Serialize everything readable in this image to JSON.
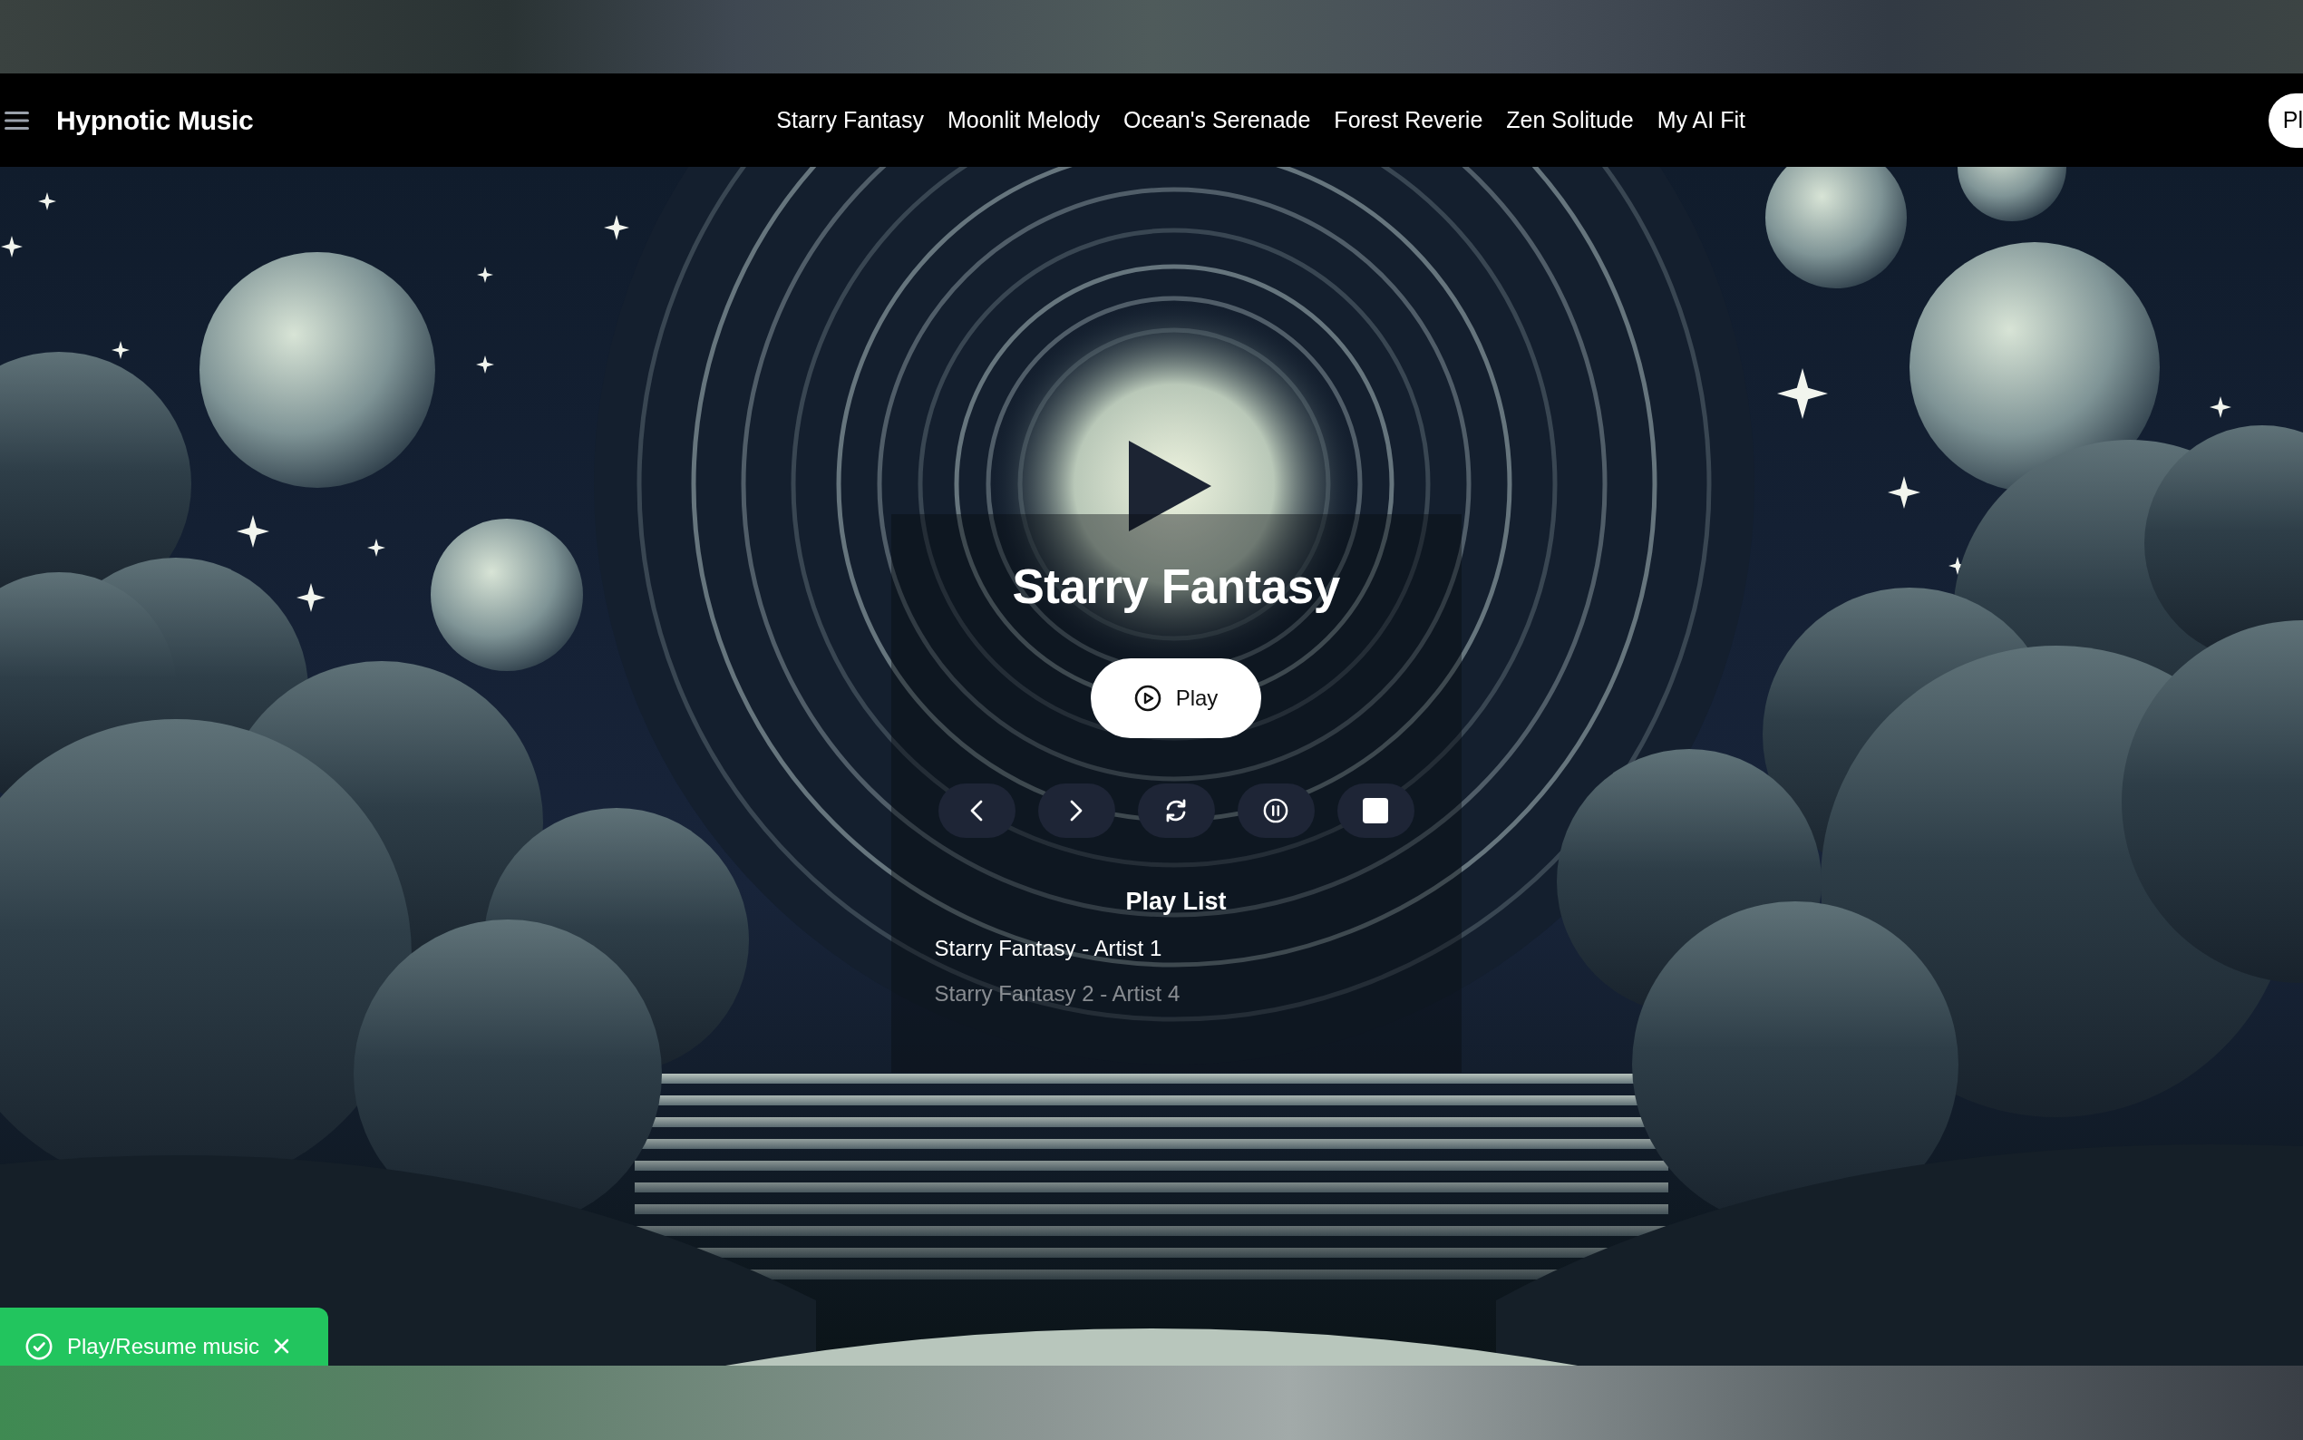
{
  "nav": {
    "brand": "Hypnotic Music",
    "links": [
      "Starry Fantasy",
      "Moonlit Melody",
      "Ocean's Serenade",
      "Forest Reverie",
      "Zen Solitude",
      "My AI Fit"
    ],
    "button": "Pl"
  },
  "player": {
    "title": "Starry Fantasy",
    "play_button": "Play",
    "controls": [
      {
        "kind": "previous"
      },
      {
        "kind": "next"
      },
      {
        "kind": "repeat"
      },
      {
        "kind": "pause"
      },
      {
        "kind": "stop"
      }
    ],
    "playlist": {
      "title": "Play List",
      "items": [
        {
          "label": "Starry Fantasy - Artist 1",
          "selected": true
        },
        {
          "label": "Starry Fantasy 2 - Artist 4",
          "selected": false
        }
      ]
    }
  },
  "toast": {
    "message": "Play/Resume music"
  }
}
